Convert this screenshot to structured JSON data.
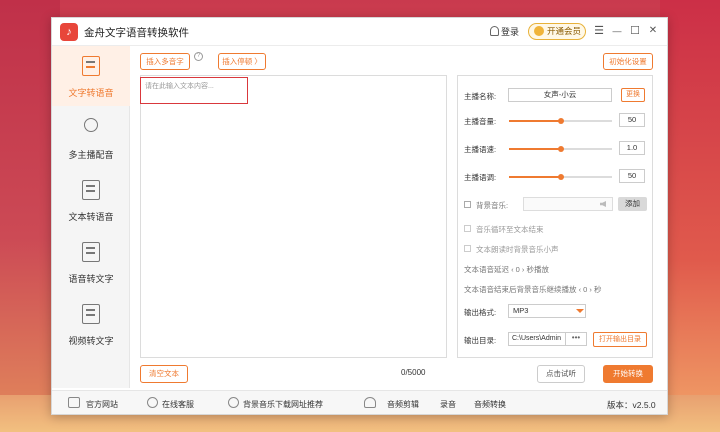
{
  "app": {
    "title": "金舟文字语音转换软件",
    "logo_glyph": "♪"
  },
  "titlebar": {
    "login_label": "登录",
    "vip_label": "开通会员",
    "menu_glyph": "☰",
    "minimize_glyph": "—",
    "maximize_glyph": "☐",
    "close_glyph": "✕"
  },
  "sidebar": {
    "items": [
      {
        "label": "文字转语音",
        "icon": "text-to-speech-icon",
        "active": true
      },
      {
        "label": "多主播配音",
        "icon": "add-person-icon",
        "active": false
      },
      {
        "label": "文本转语音",
        "icon": "document-icon",
        "active": false
      },
      {
        "label": "语音转文字",
        "icon": "speech-to-text-icon",
        "active": false
      },
      {
        "label": "视频转文字",
        "icon": "video-to-text-icon",
        "active": false
      }
    ]
  },
  "editor": {
    "insert_polyphone_label": "插入多音字",
    "insert_pause_label": "插入停顿 〉",
    "help_glyph": "?",
    "placeholder": "请在此输入文本内容...",
    "char_count": "0/5000",
    "clear_label": "清空文本"
  },
  "settings": {
    "init_label": "初始化设置",
    "voice_label": "主播名称:",
    "voice_value": "女声-小云",
    "change_label": "更换",
    "volume_label": "主播音量:",
    "volume_value": "50",
    "volume_fraction": 0.5,
    "speed_label": "主播语速:",
    "speed_value": "1.0",
    "speed_fraction": 0.5,
    "pitch_label": "主播语调:",
    "pitch_value": "50",
    "pitch_fraction": 0.5,
    "bg_music_label": "背景音乐:",
    "add_label": "添加",
    "loop_label": "音乐循环至文本结束",
    "lower_label": "文本朗读时背景音乐小声",
    "delay_text": "文本语音延迟 ‹ 0 › 秒播放",
    "after_text": "文本语音结束后背景音乐继续播放 ‹ 0 › 秒",
    "format_label": "输出格式:",
    "format_value": "MP3",
    "dir_label": "输出目录:",
    "dir_value": "C:\\Users\\Admin",
    "dir_dots": "•••",
    "open_dir_label": "打开输出目录"
  },
  "actions": {
    "audition_label": "点击试听",
    "start_label": "开始转换"
  },
  "footer": {
    "website": "官方网站",
    "service": "在线客服",
    "bg_music_download": "背景音乐下载网址推荐",
    "audio_edit": "音频剪辑",
    "record": "录音",
    "audio_convert": "音频转换",
    "version": "版本：v2.5.0"
  },
  "colors": {
    "accent": "#ef7a30",
    "highlight": "#d9383c"
  }
}
